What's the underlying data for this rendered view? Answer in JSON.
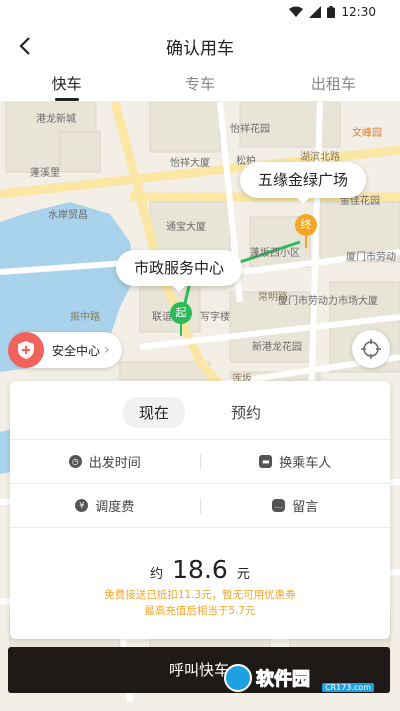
{
  "status_bar": {
    "time": "12:30"
  },
  "header": {
    "title": "确认用车"
  },
  "tabs": [
    {
      "label": "快车",
      "active": true
    },
    {
      "label": "专车",
      "active": false
    },
    {
      "label": "出租车",
      "active": false
    }
  ],
  "map": {
    "pois": [
      "港龙新城",
      "怡祥花园",
      "文峰园",
      "蓬溪里",
      "怡祥大厦",
      "松柏",
      "湖滨北路",
      "水岸贸昌",
      "通宝大厦",
      "金佳花园",
      "蓬坂西小区",
      "厦门市劳动",
      "常明路",
      "厦门市劳动力市场大厦",
      "联谊",
      "写字楼",
      "新港龙花园",
      "振中路",
      "莲坂"
    ],
    "origin_label": "市政服务中心",
    "origin_marker": "起",
    "destination_label": "五缘金绿广场",
    "destination_marker": "终",
    "safety_label": "安全中心"
  },
  "card": {
    "modes": [
      {
        "label": "现在",
        "active": true
      },
      {
        "label": "预约",
        "active": false
      }
    ],
    "options_row1": [
      {
        "label": "出发时间",
        "icon": "clock-icon"
      },
      {
        "label": "换乘车人",
        "icon": "car-icon"
      }
    ],
    "options_row2": [
      {
        "label": "调度费",
        "icon": "yen-icon"
      },
      {
        "label": "留言",
        "icon": "message-icon"
      }
    ],
    "price_prefix": "约",
    "price_value": "18.6",
    "price_unit": "元",
    "note1": "免费接送已抵扣11.3元，暂无可用优惠券",
    "note2": "最高充值后相当于5.7元"
  },
  "call_button": {
    "label": "呼叫快车"
  },
  "watermark": {
    "text": "软件园",
    "sub": "CR173.com"
  },
  "colors": {
    "origin_green": "#2dbb5a",
    "destination_orange": "#f5a623",
    "note_orange": "#f5a623",
    "call_button_bg": "#1f1a17",
    "water_blue": "#a9d3ec",
    "safety_red": "#f0625a"
  }
}
